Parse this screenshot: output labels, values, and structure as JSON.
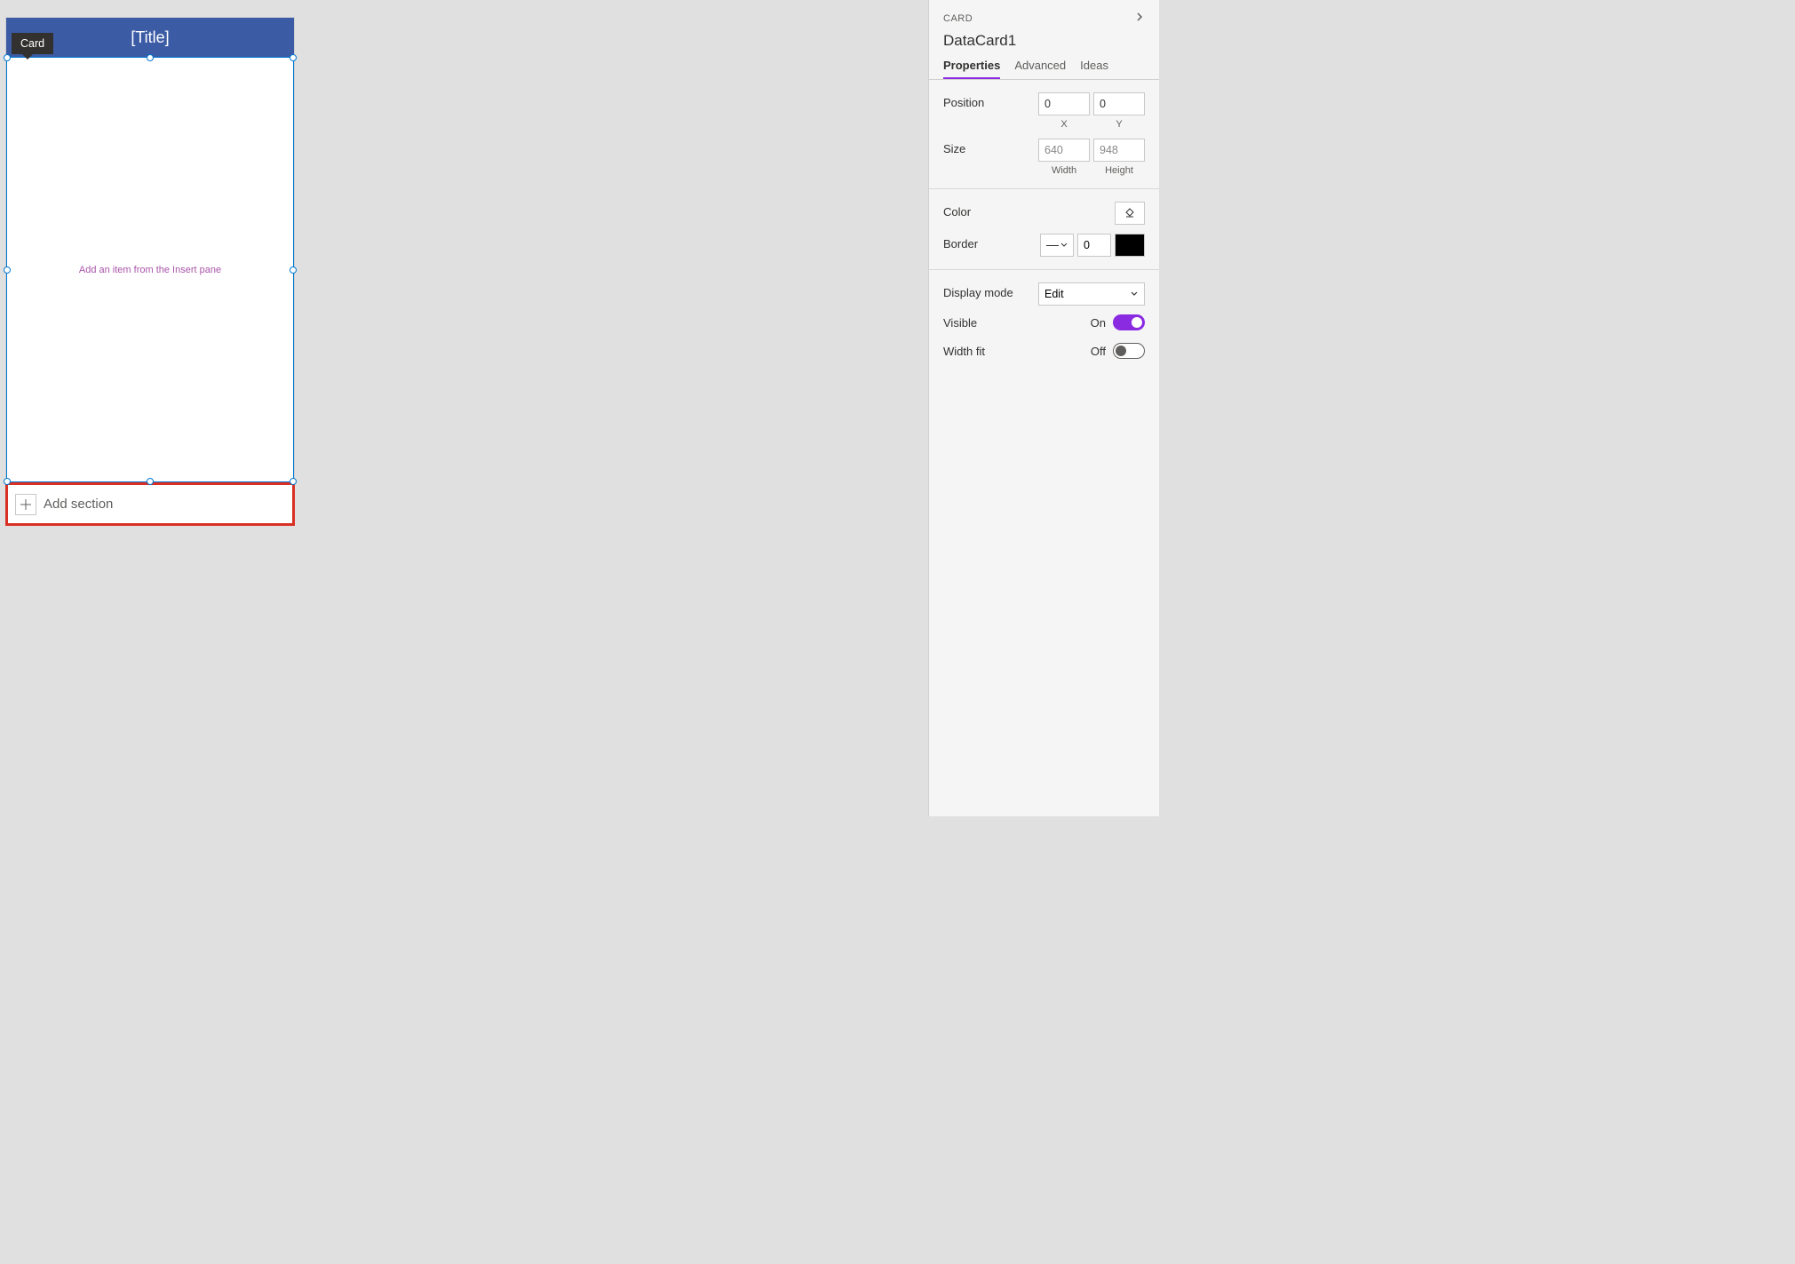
{
  "tooltip": {
    "label": "Card"
  },
  "card": {
    "title": "[Title]",
    "hint": "Add an item from the Insert pane"
  },
  "add_section": {
    "label": "Add section"
  },
  "panel": {
    "type_label": "CARD",
    "element_name": "DataCard1",
    "tabs": {
      "properties": "Properties",
      "advanced": "Advanced",
      "ideas": "Ideas"
    },
    "position": {
      "label": "Position",
      "x_value": "0",
      "y_value": "0",
      "x_sublabel": "X",
      "y_sublabel": "Y"
    },
    "size": {
      "label": "Size",
      "width_value": "640",
      "height_value": "948",
      "width_sublabel": "Width",
      "height_sublabel": "Height"
    },
    "color": {
      "label": "Color"
    },
    "border": {
      "label": "Border",
      "width_value": "0",
      "color": "#000000"
    },
    "display_mode": {
      "label": "Display mode",
      "value": "Edit"
    },
    "visible": {
      "label": "Visible",
      "state": "On"
    },
    "width_fit": {
      "label": "Width fit",
      "state": "Off"
    }
  }
}
